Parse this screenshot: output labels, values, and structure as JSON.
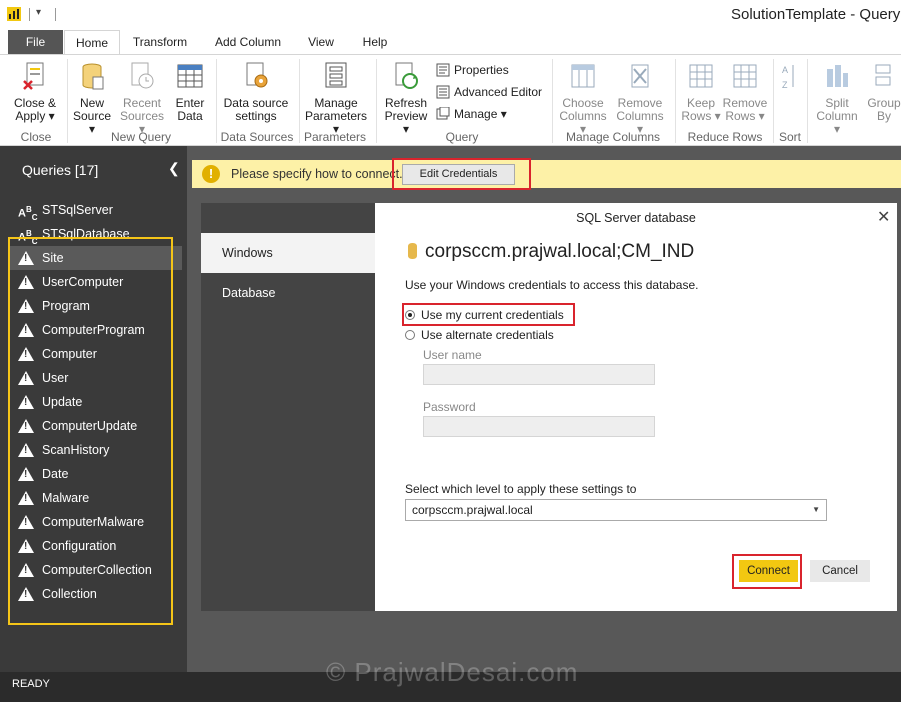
{
  "window": {
    "title": "SolutionTemplate - Query"
  },
  "tabs": [
    {
      "label": "File"
    },
    {
      "label": "Home"
    },
    {
      "label": "Transform"
    },
    {
      "label": "Add Column"
    },
    {
      "label": "View"
    },
    {
      "label": "Help"
    }
  ],
  "ribbon": {
    "close_apply": {
      "line1": "Close &",
      "line2": "Apply ▾"
    },
    "new_source": {
      "line1": "New",
      "line2": "Source ▾"
    },
    "recent_sources": {
      "line1": "Recent",
      "line2": "Sources ▾"
    },
    "enter_data": {
      "line1": "Enter",
      "line2": "Data"
    },
    "data_source_settings": {
      "line1": "Data source",
      "line2": "settings"
    },
    "manage_parameters": {
      "line1": "Manage",
      "line2": "Parameters ▾"
    },
    "refresh_preview": {
      "line1": "Refresh",
      "line2": "Preview ▾"
    },
    "properties": "Properties",
    "advanced_editor": "Advanced Editor",
    "manage": "Manage ▾",
    "choose_columns": {
      "line1": "Choose",
      "line2": "Columns ▾"
    },
    "remove_columns": {
      "line1": "Remove",
      "line2": "Columns ▾"
    },
    "keep_rows": {
      "line1": "Keep",
      "line2": "Rows ▾"
    },
    "remove_rows": {
      "line1": "Remove",
      "line2": "Rows ▾"
    },
    "split_column": {
      "line1": "Split",
      "line2": "Column ▾"
    },
    "group_by": {
      "line1": "Group",
      "line2": "By"
    },
    "groups": {
      "close": "Close",
      "new_query": "New Query",
      "data_sources": "Data Sources",
      "parameters": "Parameters",
      "query": "Query",
      "manage_columns": "Manage Columns",
      "reduce_rows": "Reduce Rows",
      "sort": "Sort"
    }
  },
  "queries_pane": {
    "header": "Queries [17]",
    "items": [
      {
        "label": "STSqlServer",
        "icon": "abc-text-icon"
      },
      {
        "label": "STSqlDatabase",
        "icon": "abc-text-icon"
      },
      {
        "label": "Site",
        "icon": "warning-icon"
      },
      {
        "label": "UserComputer",
        "icon": "warning-icon"
      },
      {
        "label": "Program",
        "icon": "warning-icon"
      },
      {
        "label": "ComputerProgram",
        "icon": "warning-icon"
      },
      {
        "label": "Computer",
        "icon": "warning-icon"
      },
      {
        "label": "User",
        "icon": "warning-icon"
      },
      {
        "label": "Update",
        "icon": "warning-icon"
      },
      {
        "label": "ComputerUpdate",
        "icon": "warning-icon"
      },
      {
        "label": "ScanHistory",
        "icon": "warning-icon"
      },
      {
        "label": "Date",
        "icon": "warning-icon"
      },
      {
        "label": "Malware",
        "icon": "warning-icon"
      },
      {
        "label": "ComputerMalware",
        "icon": "warning-icon"
      },
      {
        "label": "Configuration",
        "icon": "warning-icon"
      },
      {
        "label": "ComputerCollection",
        "icon": "warning-icon"
      },
      {
        "label": "Collection",
        "icon": "warning-icon"
      }
    ]
  },
  "warning_bar": {
    "message": "Please specify how to connect.",
    "button": "Edit Credentials"
  },
  "dialog": {
    "title": "SQL Server database",
    "side_items": [
      "Windows",
      "Database"
    ],
    "server": "corpsccm.prajwal.local;CM_IND",
    "description": "Use your Windows credentials to access this database.",
    "option_current": "Use my current credentials",
    "option_alternate": "Use alternate credentials",
    "username_label": "User name",
    "password_label": "Password",
    "level_label": "Select which level to apply these settings to",
    "level_value": "corpsccm.prajwal.local",
    "connect": "Connect",
    "cancel": "Cancel"
  },
  "status": {
    "text": "READY"
  },
  "watermark": "© PrajwalDesai.com",
  "colors": {
    "accent": "#f2c811",
    "highlight_red": "#d9242d",
    "highlight_yellow": "#f5c518"
  }
}
